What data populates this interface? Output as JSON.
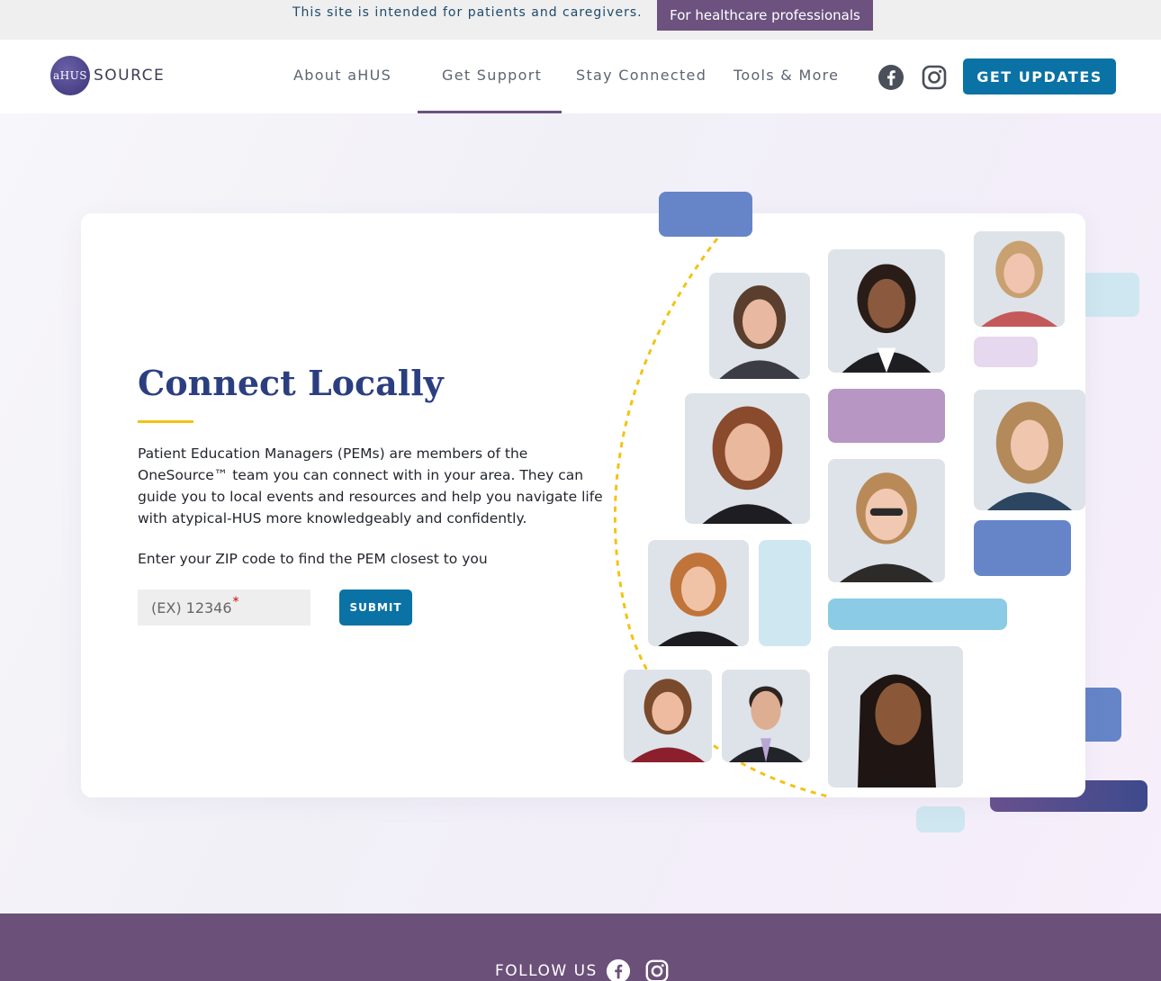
{
  "top_banner": {
    "notice": "This site is intended for patients and caregivers.",
    "hcp_button": "For healthcare professionals"
  },
  "header": {
    "logo_mark": "aHUS",
    "logo_text": "SOURCE",
    "nav": [
      "About aHUS",
      "Get Support",
      "Stay Connected",
      "Tools & More"
    ],
    "active_nav": "Get Support",
    "social_icons": [
      "facebook-icon",
      "instagram-icon"
    ],
    "cta": "GET UPDATES"
  },
  "main": {
    "title": "Connect Locally",
    "description": "Patient Education Managers (PEMs) are members of the OneSource™ team you can connect with in your area. They can guide you to local events and resources and help you navigate life with atypical-HUS more knowledgeably and confidently.",
    "zip_prompt": "Enter your ZIP code to find the PEM closest to you",
    "zip_placeholder": "(EX) 12346",
    "zip_required_mark": "*",
    "submit": "SUBMIT"
  },
  "footer": {
    "follow": "FOLLOW US",
    "social_icons": [
      "facebook-icon",
      "instagram-icon"
    ]
  },
  "colors": {
    "brand_purple": "#6d5280",
    "brand_blue": "#0a72a4",
    "heading_navy": "#2b3f80",
    "accent_yellow": "#f2c314"
  }
}
